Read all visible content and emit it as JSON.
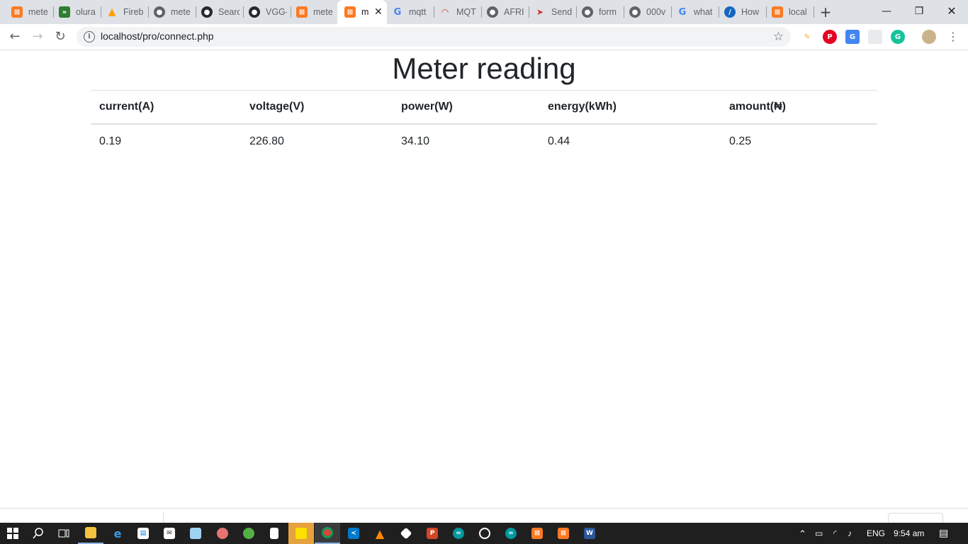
{
  "browser": {
    "tabs": [
      {
        "title": "mete",
        "icon": "xampp-icon",
        "color": "#fb7a24",
        "active": false
      },
      {
        "title": "olura",
        "icon": "code-icon",
        "color": "#2e7d32",
        "active": false
      },
      {
        "title": "Fireb",
        "icon": "firebase-icon",
        "color": "#ffca28",
        "active": false
      },
      {
        "title": "mete",
        "icon": "globe-icon",
        "color": "#5f6368",
        "active": false
      },
      {
        "title": "Searc",
        "icon": "github-icon",
        "color": "#24292e",
        "active": false
      },
      {
        "title": "VGG-",
        "icon": "github-icon",
        "color": "#24292e",
        "active": false
      },
      {
        "title": "mete",
        "icon": "xampp-icon",
        "color": "#fb7a24",
        "active": false
      },
      {
        "title": "m",
        "icon": "xampp-icon",
        "color": "#fb7a24",
        "active": true
      },
      {
        "title": "mqtt",
        "icon": "google-icon",
        "color": "#4285f4",
        "active": false
      },
      {
        "title": "MQT",
        "icon": "rainbow-icon",
        "color": "#e53935",
        "active": false
      },
      {
        "title": "AFRI",
        "icon": "globe-icon",
        "color": "#5f6368",
        "active": false
      },
      {
        "title": "Send",
        "icon": "send-icon",
        "color": "#d32f2f",
        "active": false
      },
      {
        "title": "form",
        "icon": "globe-icon",
        "color": "#5f6368",
        "active": false
      },
      {
        "title": "000v",
        "icon": "globe-icon",
        "color": "#5f6368",
        "active": false
      },
      {
        "title": "what",
        "icon": "google-icon",
        "color": "#4285f4",
        "active": false
      },
      {
        "title": "How",
        "icon": "edge-circle-icon",
        "color": "#1565c0",
        "active": false
      },
      {
        "title": "local",
        "icon": "xampp-icon",
        "color": "#fb7a24",
        "active": false
      }
    ],
    "new_tab": "+",
    "url": "localhost/pro/connect.php"
  },
  "page": {
    "title": "Meter reading",
    "table": {
      "headers": [
        "current(A)",
        "voltage(V)",
        "power(W)",
        "energy(kWh)",
        "amount(₦)"
      ],
      "rows": [
        [
          "0.19",
          "226.80",
          "34.10",
          "0.44",
          "0.25"
        ]
      ]
    }
  },
  "taskbar": {
    "apps": [
      "file-explorer-icon",
      "edge-icon",
      "store-icon",
      "mail-icon",
      "notepad-icon",
      "paint-icon",
      "xbox-icon",
      "document-icon",
      "sticky-notes-icon",
      "chrome-icon",
      "vscode-icon",
      "vlc-icon",
      "git-icon",
      "powerpoint-icon",
      "arduino-icon",
      "github-desktop-icon",
      "arduino-icon",
      "xampp-icon",
      "xampp-icon",
      "word-icon"
    ],
    "language": "ENG",
    "time": "9:54 am"
  }
}
